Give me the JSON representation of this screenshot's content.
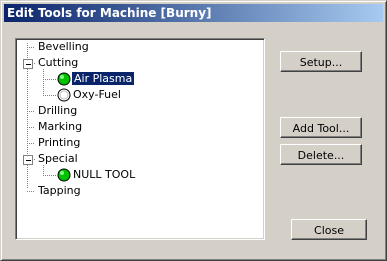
{
  "window": {
    "title": "Edit Tools for Machine [Burny]"
  },
  "tree": {
    "items": [
      {
        "label": "Bevelling"
      },
      {
        "label": "Cutting",
        "expanded": true,
        "children": [
          {
            "label": "Air Plasma",
            "selected": true,
            "status": "active"
          },
          {
            "label": "Oxy-Fuel",
            "status": "inactive"
          }
        ]
      },
      {
        "label": "Drilling"
      },
      {
        "label": "Marking"
      },
      {
        "label": "Printing"
      },
      {
        "label": "Special",
        "expanded": true,
        "children": [
          {
            "label": "NULL TOOL",
            "status": "active"
          }
        ]
      },
      {
        "label": "Tapping"
      }
    ]
  },
  "buttons": {
    "setup": "Setup...",
    "add_tool": "Add Tool...",
    "delete": "Delete...",
    "close": "Close"
  },
  "colors": {
    "active_icon": "#00c000",
    "inactive_icon": "#ffffff",
    "selection": "#0a246a",
    "title_start": "#0a246a",
    "title_end": "#a6caf0"
  }
}
